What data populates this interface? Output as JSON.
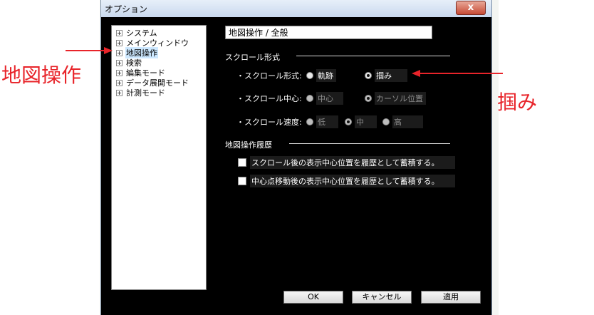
{
  "window": {
    "title": "オプション",
    "close_glyph": "x"
  },
  "tree": {
    "items": [
      {
        "label": "システム",
        "selected": false
      },
      {
        "label": "メインウィンドウ",
        "selected": false
      },
      {
        "label": "地図操作",
        "selected": true
      },
      {
        "label": "検索",
        "selected": false
      },
      {
        "label": "編集モード",
        "selected": false
      },
      {
        "label": "データ展開モード",
        "selected": false
      },
      {
        "label": "計測モード",
        "selected": false
      }
    ]
  },
  "panel": {
    "heading": "地図操作 / 全般",
    "scroll_group": {
      "title": "スクロール形式",
      "type_label": "・スクロール形式:",
      "type_options": [
        {
          "label": "軌跡",
          "checked": false
        },
        {
          "label": "掴み",
          "checked": true
        }
      ],
      "center_label": "・スクロール中心:",
      "center_options": [
        {
          "label": "中心",
          "checked": false
        },
        {
          "label": "カーソル位置",
          "checked": true
        }
      ],
      "speed_label": "・スクロール速度:",
      "speed_options": [
        {
          "label": "低",
          "checked": false
        },
        {
          "label": "中",
          "checked": true
        },
        {
          "label": "高",
          "checked": false
        }
      ]
    },
    "history_group": {
      "title": "地図操作履歴",
      "check1": "スクロール後の表示中心位置を履歴として蓄積する。",
      "check2": "中心点移動後の表示中心位置を履歴として蓄積する。"
    }
  },
  "buttons": {
    "ok": "OK",
    "cancel": "キャンセル",
    "apply": "適用"
  },
  "annotations": {
    "left": "地図操作",
    "right": "掴み",
    "color": "#e8242a"
  }
}
